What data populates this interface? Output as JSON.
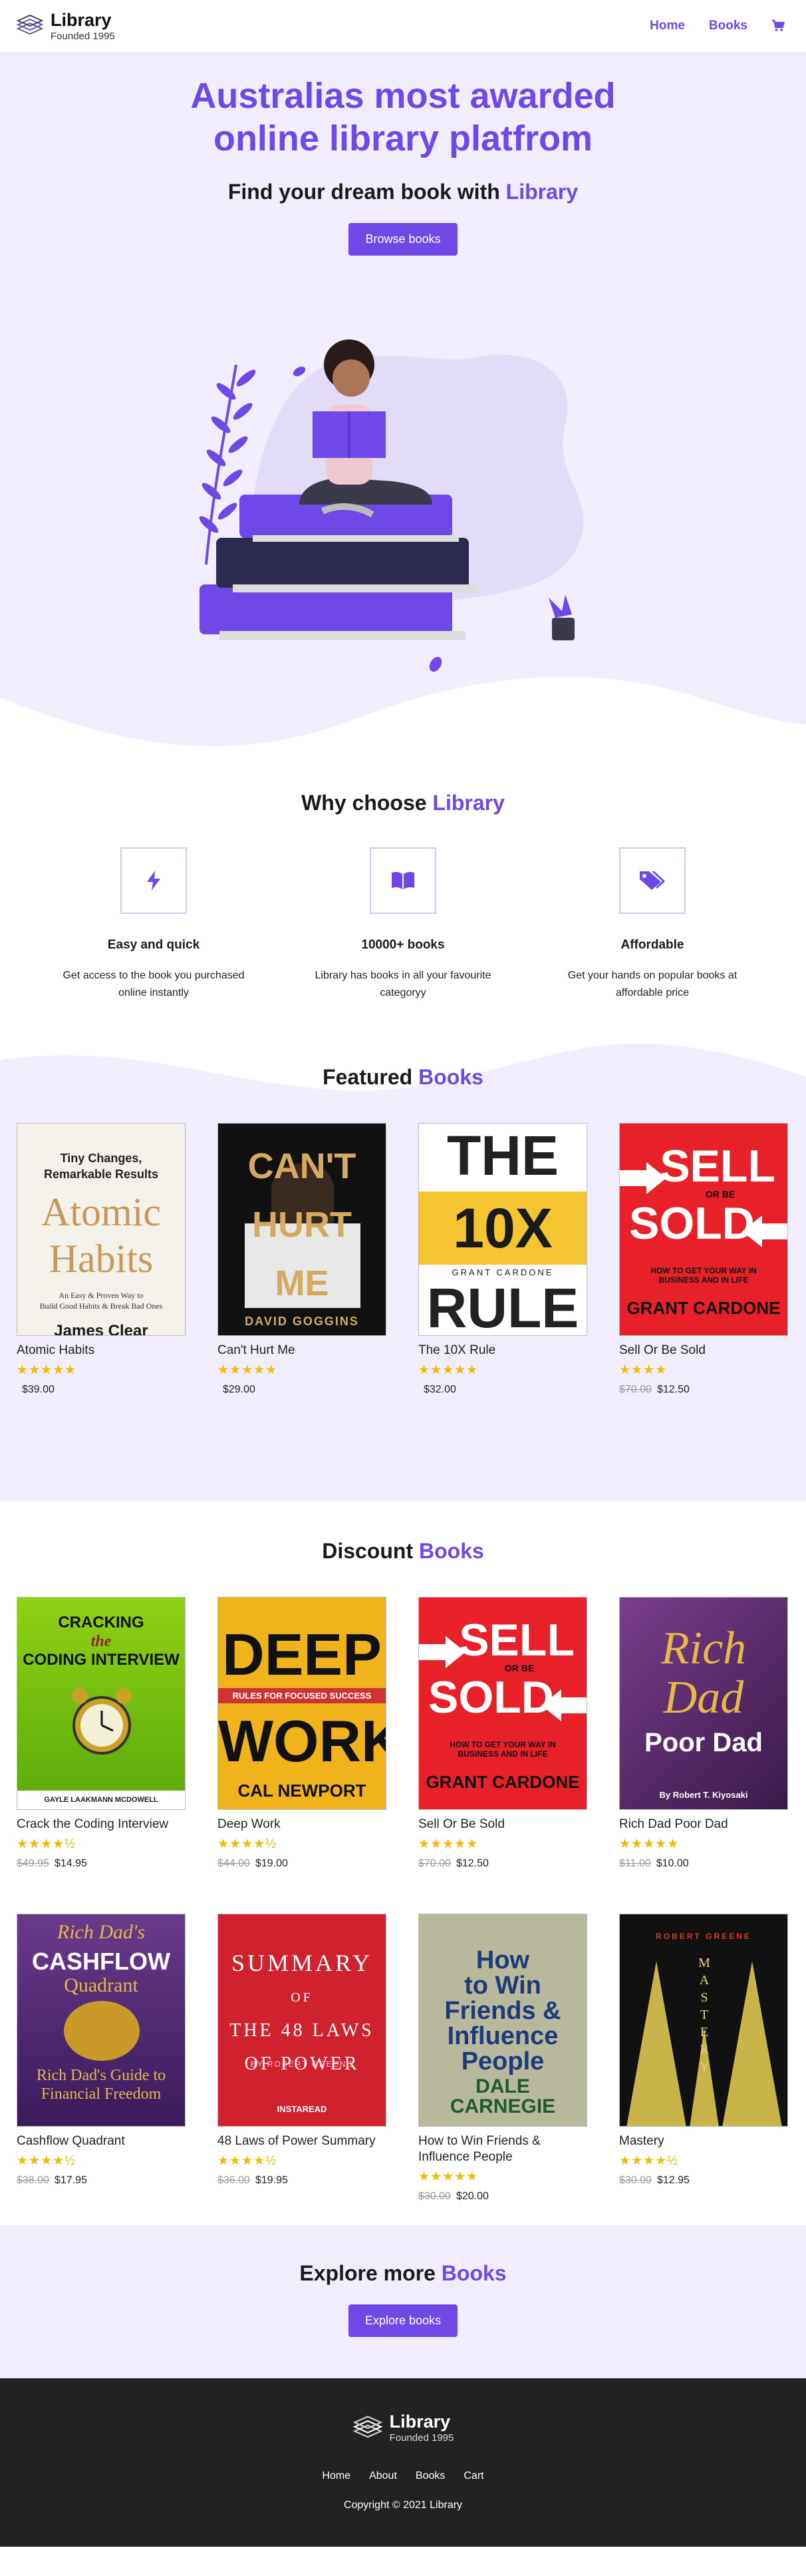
{
  "nav": {
    "logo_name": "Library",
    "logo_sub": "Founded 1995",
    "links": [
      "Home",
      "Books"
    ]
  },
  "hero": {
    "title": "Australias most awarded online library platfrom",
    "subtitle": "Find your dream book with",
    "subtitle_accent": "Library",
    "button": "Browse books"
  },
  "why": {
    "title": "Why choose",
    "title_accent": "Library",
    "features": [
      {
        "icon": "bolt-icon",
        "title": "Easy and quick",
        "text": "Get access to the book you purchased online instantly"
      },
      {
        "icon": "book-icon",
        "title": "10000+ books",
        "text": "Library has books in all your favourite categoryy"
      },
      {
        "icon": "tags-icon",
        "title": "Affordable",
        "text": "Get your hands on popular books at affordable price"
      }
    ]
  },
  "featured": {
    "title": "Featured",
    "title_accent": "Books",
    "books": [
      {
        "title": "Atomic Habits",
        "stars": "★★★★★",
        "old": "",
        "price": "$39.00",
        "cover_lines": [
          "Tiny Changes,",
          "Remarkable Results",
          "Atomic",
          "Habits",
          "An Easy & Proven Way to",
          "Build Good Habits & Break Bad Ones",
          "James Clear"
        ]
      },
      {
        "title": "Can't Hurt Me",
        "stars": "★★★★★",
        "old": "",
        "price": "$29.00",
        "cover_lines": [
          "CAN'T",
          "HURT",
          "ME",
          "DAVID GOGGINS"
        ]
      },
      {
        "title": "The 10X Rule",
        "stars": "★★★★★",
        "old": "",
        "price": "$32.00",
        "cover_lines": [
          "THE",
          "10X",
          "RULE",
          "GRANT CARDONE"
        ]
      },
      {
        "title": "Sell Or Be Sold",
        "stars": "★★★★",
        "old": "$70.00",
        "price": "$12.50",
        "cover_lines": [
          "SELL",
          "OR BE",
          "SOLD",
          "HOW TO GET YOUR WAY IN BUSINESS AND IN LIFE",
          "GRANT CARDONE"
        ]
      }
    ]
  },
  "discount": {
    "title": "Discount",
    "title_accent": "Books",
    "books": [
      {
        "title": "Crack the Coding Interview",
        "stars": "★★★★½",
        "old": "$49.95",
        "price": "$14.95",
        "cover_lines": [
          "CRACKING",
          "the",
          "CODING INTERVIEW",
          "GAYLE LAAKMANN MCDOWELL"
        ]
      },
      {
        "title": "Deep Work",
        "stars": "★★★★½",
        "old": "$44.00",
        "price": "$19.00",
        "cover_lines": [
          "DEEP",
          "RULES FOR FOCUSED SUCCESS",
          "WORK",
          "CAL NEWPORT"
        ]
      },
      {
        "title": "Sell Or Be Sold",
        "stars": "★★★★★",
        "old": "$70.00",
        "price": "$12.50",
        "cover_lines": [
          "SELL",
          "OR BE",
          "SOLD",
          "HOW TO GET YOUR WAY IN BUSINESS AND IN LIFE",
          "GRANT CARDONE"
        ]
      },
      {
        "title": "Rich Dad Poor Dad",
        "stars": "★★★★★",
        "old": "$11.00",
        "price": "$10.00",
        "cover_lines": [
          "Rich",
          "Dad",
          "Poor Dad",
          "By Robert T. Kiyosaki"
        ]
      },
      {
        "title": "Cashflow Quadrant",
        "stars": "★★★★½",
        "old": "$38.00",
        "price": "$17.95",
        "cover_lines": [
          "Rich Dad's",
          "CASHFLOW",
          "Quadrant",
          "Rich Dad's Guide to",
          "Financial Freedom"
        ]
      },
      {
        "title": "48 Laws of Power Summary",
        "stars": "★★★★½",
        "old": "$36.00",
        "price": "$19.95",
        "cover_lines": [
          "SUMMARY",
          "OF",
          "THE 48 LAWS",
          "OF POWER",
          "BY ROBERT GREENE",
          "INSTAREAD"
        ]
      },
      {
        "title": "How to Win Friends & Influence People",
        "stars": "★★★★★",
        "old": "$30.00",
        "price": "$20.00",
        "cover_lines": [
          "How",
          "to Win",
          "Friends &",
          "Influence",
          "People",
          "DALE",
          "CARNEGIE"
        ]
      },
      {
        "title": "Mastery",
        "stars": "★★★★½",
        "old": "$30.00",
        "price": "$12.95",
        "cover_lines": [
          "ROBERT GREENE",
          "MASTERY"
        ]
      }
    ]
  },
  "explore": {
    "title": "Explore more",
    "title_accent": "Books",
    "button": "Explore books"
  },
  "footer": {
    "logo_name": "Library",
    "logo_sub": "Founded 1995",
    "links": [
      "Home",
      "About",
      "Books",
      "Cart"
    ],
    "copyright": "Copyright © 2021 Library"
  },
  "colors": {
    "accent": "#7048e8",
    "hero_bg": "#f1edfd",
    "footer_bg": "#222222",
    "star": "#f5b800"
  }
}
